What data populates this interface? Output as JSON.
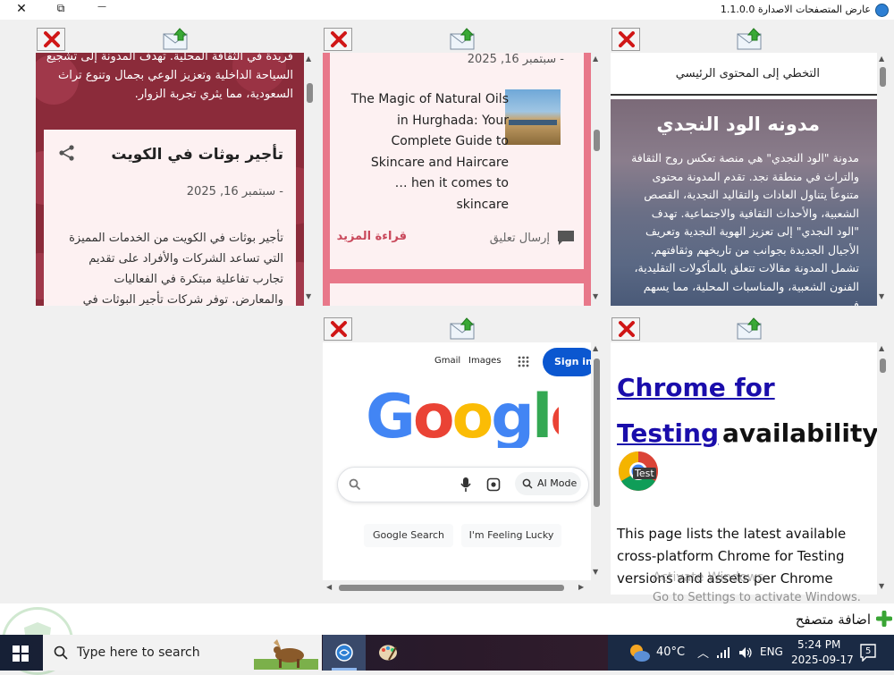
{
  "window": {
    "title": "عارض المتصفحات الاصدارة 1.1.0.0",
    "close_label": "✕",
    "restore_label": "⧉",
    "minimize_label": "—"
  },
  "panes": {
    "top_left": {
      "intro_text": "فريدة في الثقافة المحلية. تهدف المدونة إلى تشجيع السياحة الداخلية وتعزيز الوعي بجمال وتنوع تراث السعودية، مما يثري تجربة الزوار.",
      "card_title": "تأجير بوثات في الكويت",
      "card_date": "- سبتمبر 16, 2025",
      "card_body": "تأجير بوثات في الكويت من الخدمات المميزة التي تساعد الشركات والأفراد على تقديم تجارب تفاعلية مبتكرة في الفعاليات والمعارض. توفر شركات تأجير البوثات في"
    },
    "top_middle": {
      "date": "- سبتمبر 16, 2025",
      "post_title": "The Magic of Natural Oils in Hurghada: Your Complete Guide to Skincare and Haircare",
      "excerpt_end": "… hen it comes to skincare",
      "read_more": "قراءة المزيد",
      "send_comment": "إرسال تعليق"
    },
    "top_right": {
      "skip_link": "التخطي إلى المحتوى الرئيسي",
      "blog_title": "مدونه الود النجدي",
      "blog_desc": "مدونة \"الود النجدي\" هي منصة تعكس روح الثقافة والتراث في منطقة نجد. تقدم المدونة محتوى متنوعاً يتناول العادات والتقاليد النجدية، القصص الشعبية، والأحداث الثقافية والاجتماعية. تهدف \"الود النجدي\" إلى تعزيز الهوية النجدية وتعريف الأجيال الجديدة بجوانب من تاريخهم وثقافتهم. تشمل المدونة مقالات تتعلق بالمأكولات التقليدية، الفنون الشعبية، والمناسبات المحلية، مما يسهم في"
    },
    "bottom_middle": {
      "gmail": "Gmail",
      "images": "Images",
      "sign_in": "Sign in",
      "ai_mode": "AI Mode",
      "google_search": "Google Search",
      "feeling_lucky": "I'm Feeling Lucky"
    },
    "bottom_right": {
      "heading_link": "Chrome for Testing",
      "heading_rest": "availability",
      "badge": "Test",
      "paragraph": "This page lists the latest available cross-platform Chrome for Testing versions and assets per Chrome release channel."
    }
  },
  "watermark": {
    "line1": "Activate Windows",
    "line2": "Go to Settings to activate Windows."
  },
  "add_browser_label": "اضافة متصفح",
  "taskbar": {
    "search_placeholder": "Type here to search",
    "temperature": "40°C",
    "language": "ENG",
    "time": "5:24 PM",
    "date": "2025-09-17",
    "notification_count": "5"
  },
  "colors": {
    "close_red": "#d01616",
    "google_blue": "#0b57d0",
    "rose_border": "#e8788a",
    "read_more": "#c9485b",
    "link_blue": "#1a0dab"
  }
}
